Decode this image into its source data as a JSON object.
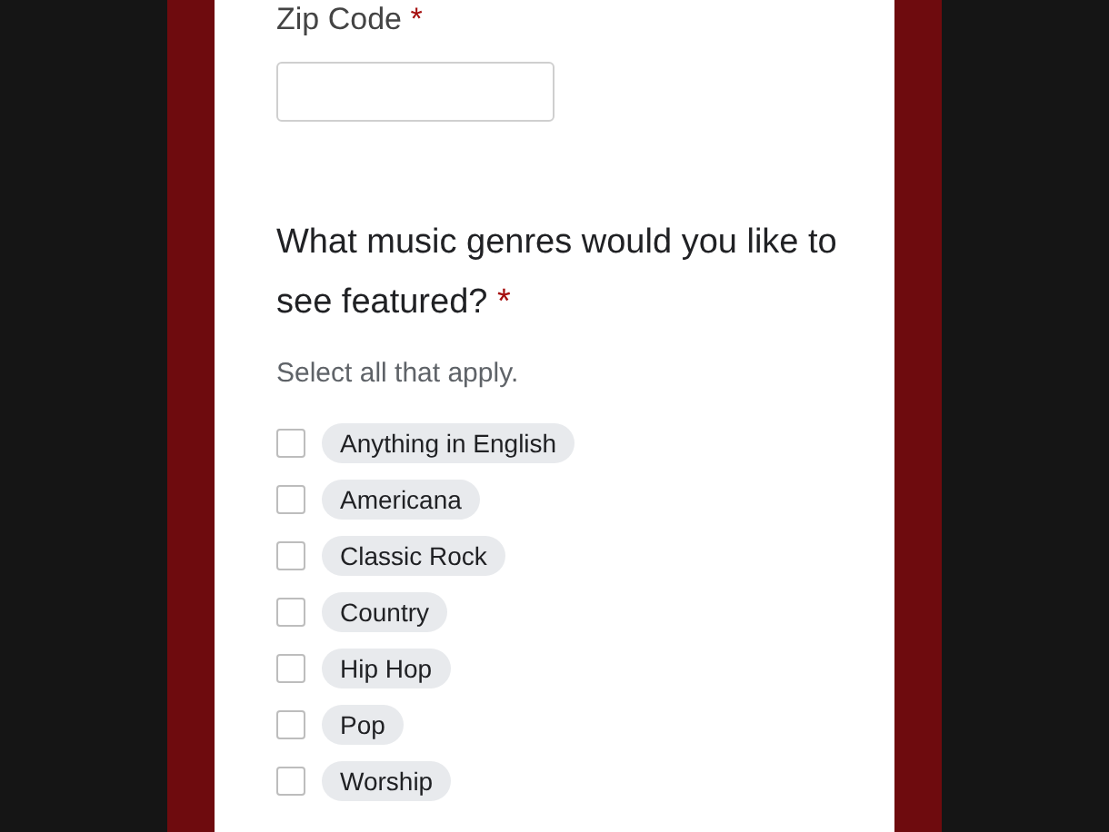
{
  "zip_field": {
    "label": "Zip Code",
    "required_mark": "*"
  },
  "question": {
    "title": "What music genres would you like to see featured?",
    "required_mark": "*",
    "hint": "Select all that apply.",
    "options": [
      {
        "label": "Anything in English",
        "checked": false
      },
      {
        "label": "Americana",
        "checked": false
      },
      {
        "label": "Classic Rock",
        "checked": false
      },
      {
        "label": "Country",
        "checked": false
      },
      {
        "label": "Hip Hop",
        "checked": false
      },
      {
        "label": "Pop",
        "checked": false
      },
      {
        "label": "Worship",
        "checked": false
      }
    ]
  }
}
